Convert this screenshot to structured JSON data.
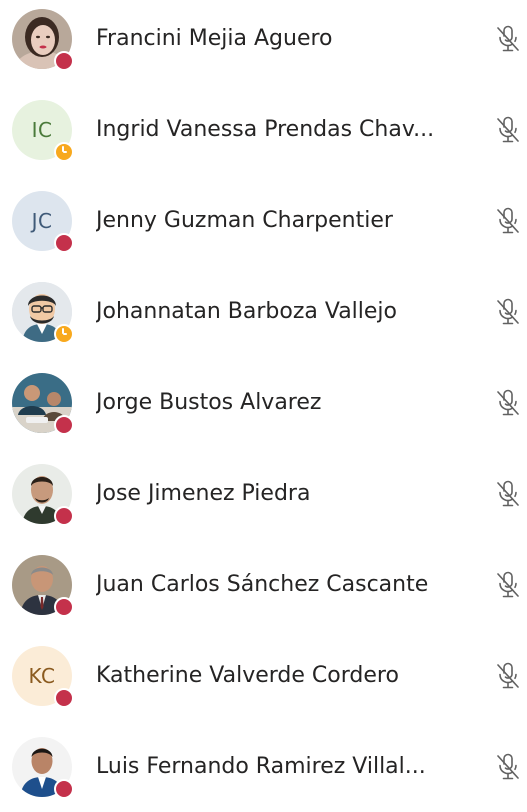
{
  "participants": [
    {
      "name": "Francini Mejia Aguero",
      "initials": "",
      "status": "busy",
      "avatar": "photo-woman-icon",
      "mic": "mic-off-icon"
    },
    {
      "name": "Ingrid Vanessa Prendas Chav...",
      "initials": "IC",
      "status": "away",
      "avatar_bg": "#e7f2df",
      "avatar_fg": "#4a7a3a",
      "mic": "mic-off-icon"
    },
    {
      "name": "Jenny Guzman Charpentier",
      "initials": "JC",
      "status": "busy",
      "avatar_bg": "#dde5ee",
      "avatar_fg": "#3f5a78",
      "mic": "mic-off-icon"
    },
    {
      "name": "Johannatan Barboza Vallejo",
      "initials": "",
      "status": "away",
      "avatar": "cartoon-man-icon",
      "mic": "mic-off-icon"
    },
    {
      "name": "Jorge Bustos Alvarez",
      "initials": "",
      "status": "busy",
      "avatar": "photo-group-icon",
      "mic": "mic-off-icon"
    },
    {
      "name": "Jose Jimenez Piedra",
      "initials": "",
      "status": "busy",
      "avatar": "photo-man-icon",
      "mic": "mic-off-icon"
    },
    {
      "name": "Juan Carlos Sánchez Cascante",
      "initials": "",
      "status": "busy",
      "avatar": "photo-man-suit-icon",
      "mic": "mic-off-icon"
    },
    {
      "name": "Katherine Valverde Cordero",
      "initials": "KC",
      "status": "busy",
      "avatar_bg": "#fbecd7",
      "avatar_fg": "#8a5a1e",
      "mic": "mic-off-icon"
    },
    {
      "name": "Luis Fernando Ramirez Villal...",
      "initials": "",
      "status": "busy",
      "avatar": "photo-man-blue-icon",
      "mic": "mic-off-icon"
    }
  ],
  "colors": {
    "busy": "#c4314b",
    "away": "#f8a91e",
    "text": "#252424",
    "icon": "#616161"
  }
}
